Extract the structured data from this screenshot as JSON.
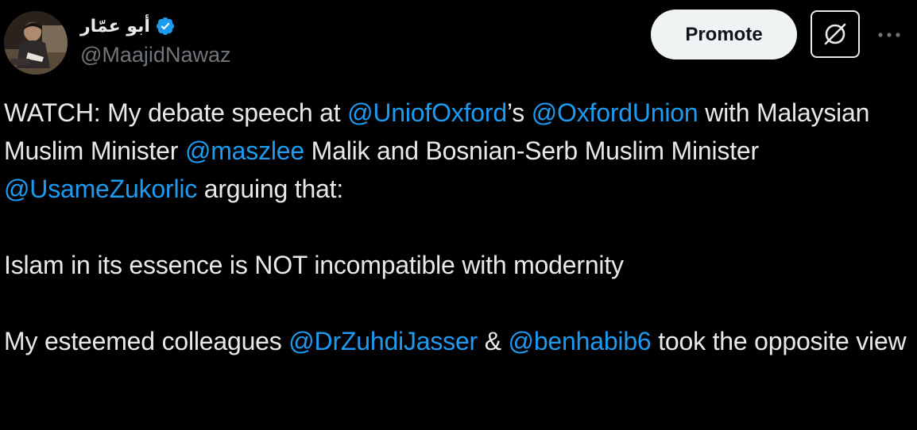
{
  "author": {
    "display_name": "أبو عمّار",
    "handle": "@MaajidNawaz",
    "verified_icon": "verified-badge-icon",
    "avatar_icon": "profile-photo"
  },
  "actions": {
    "promote_label": "Promote",
    "grok_icon": "grok-icon",
    "more_icon": "more-options-icon"
  },
  "colors": {
    "background": "#000000",
    "text": "#e7e9ea",
    "secondary_text": "#71767b",
    "link": "#1d9bf0",
    "verified": "#1d9bf0",
    "promote_bg": "#eff3f4"
  },
  "tweet": {
    "p1": {
      "t1": "WATCH: My debate speech at ",
      "m1": "@UniofOxford",
      "t2": "’s ",
      "m2": "@OxfordUnion",
      "t3": " with Malaysian Muslim Minister ",
      "m3": "@maszlee",
      "t4": " Malik and Bosnian-Serb Muslim Minister ",
      "m4": "@UsameZukorlic",
      "t5": " arguing that:"
    },
    "p2": {
      "t1": "Islam in its essence is NOT incompatible with modernity"
    },
    "p3": {
      "t1": "My esteemed colleagues ",
      "m1": "@DrZuhdiJasser",
      "t2": " & ",
      "m2": "@benhabib6",
      "t3": " took the opposite view"
    }
  }
}
